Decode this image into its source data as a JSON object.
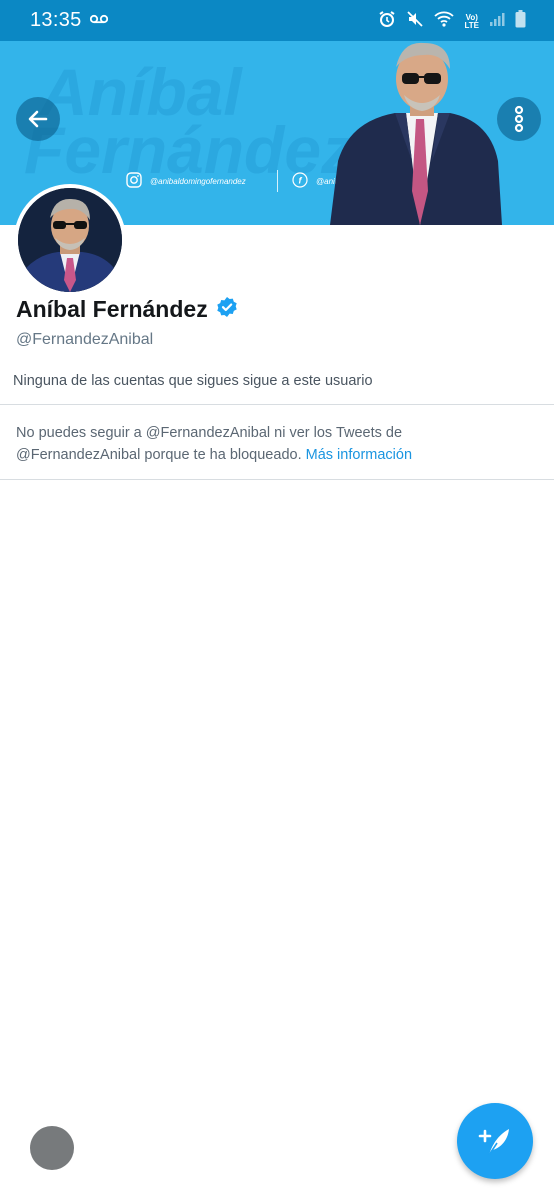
{
  "status_bar": {
    "time": "13:35",
    "network_top": "Vo)",
    "network_bottom": "LTE"
  },
  "banner": {
    "watermark_line1": "Aníbal",
    "watermark_line2": "Fernández",
    "instagram_handle": "@anibaldomingofernandez",
    "facebook_handle": "@anibalfernandezpaginaoficial",
    "color": "#33b4ea"
  },
  "profile": {
    "display_name": "Aníbal Fernández",
    "handle": "@FernandezAnibal",
    "followers_you_know": "Ninguna de las cuentas que sigues sigue a este usuario",
    "blocked_message": "No puedes seguir a @FernandezAnibal ni ver los Tweets de @FernandezAnibal porque te ha bloqueado.",
    "more_info_link": "Más información"
  },
  "icons": {
    "back": "arrow-left-icon",
    "more": "more-vertical-icon",
    "verified": "verified-badge-icon",
    "compose": "compose-tweet-icon"
  },
  "colors": {
    "accent": "#1da1f2",
    "link": "#1b95e0",
    "status_bar": "#0b88c4"
  }
}
